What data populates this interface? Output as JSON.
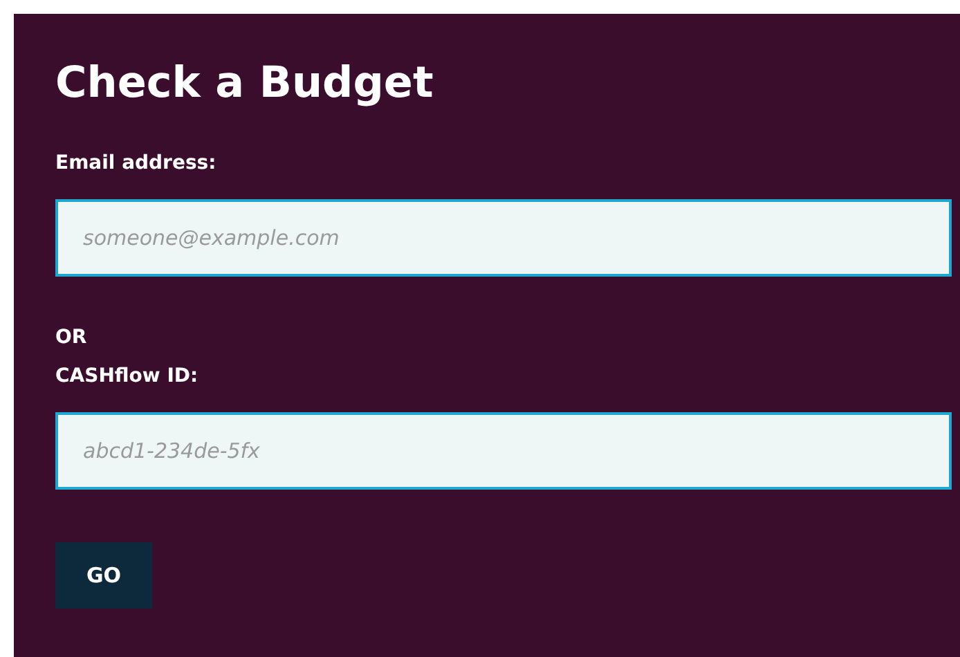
{
  "title": "Check a Budget",
  "fields": [
    {
      "label": "Email address:",
      "placeholder": "someone@example.com"
    },
    {
      "prefix": "OR",
      "label": "CASHflow ID:",
      "placeholder": "abcd1-234de-5fx"
    }
  ],
  "button": "GO"
}
